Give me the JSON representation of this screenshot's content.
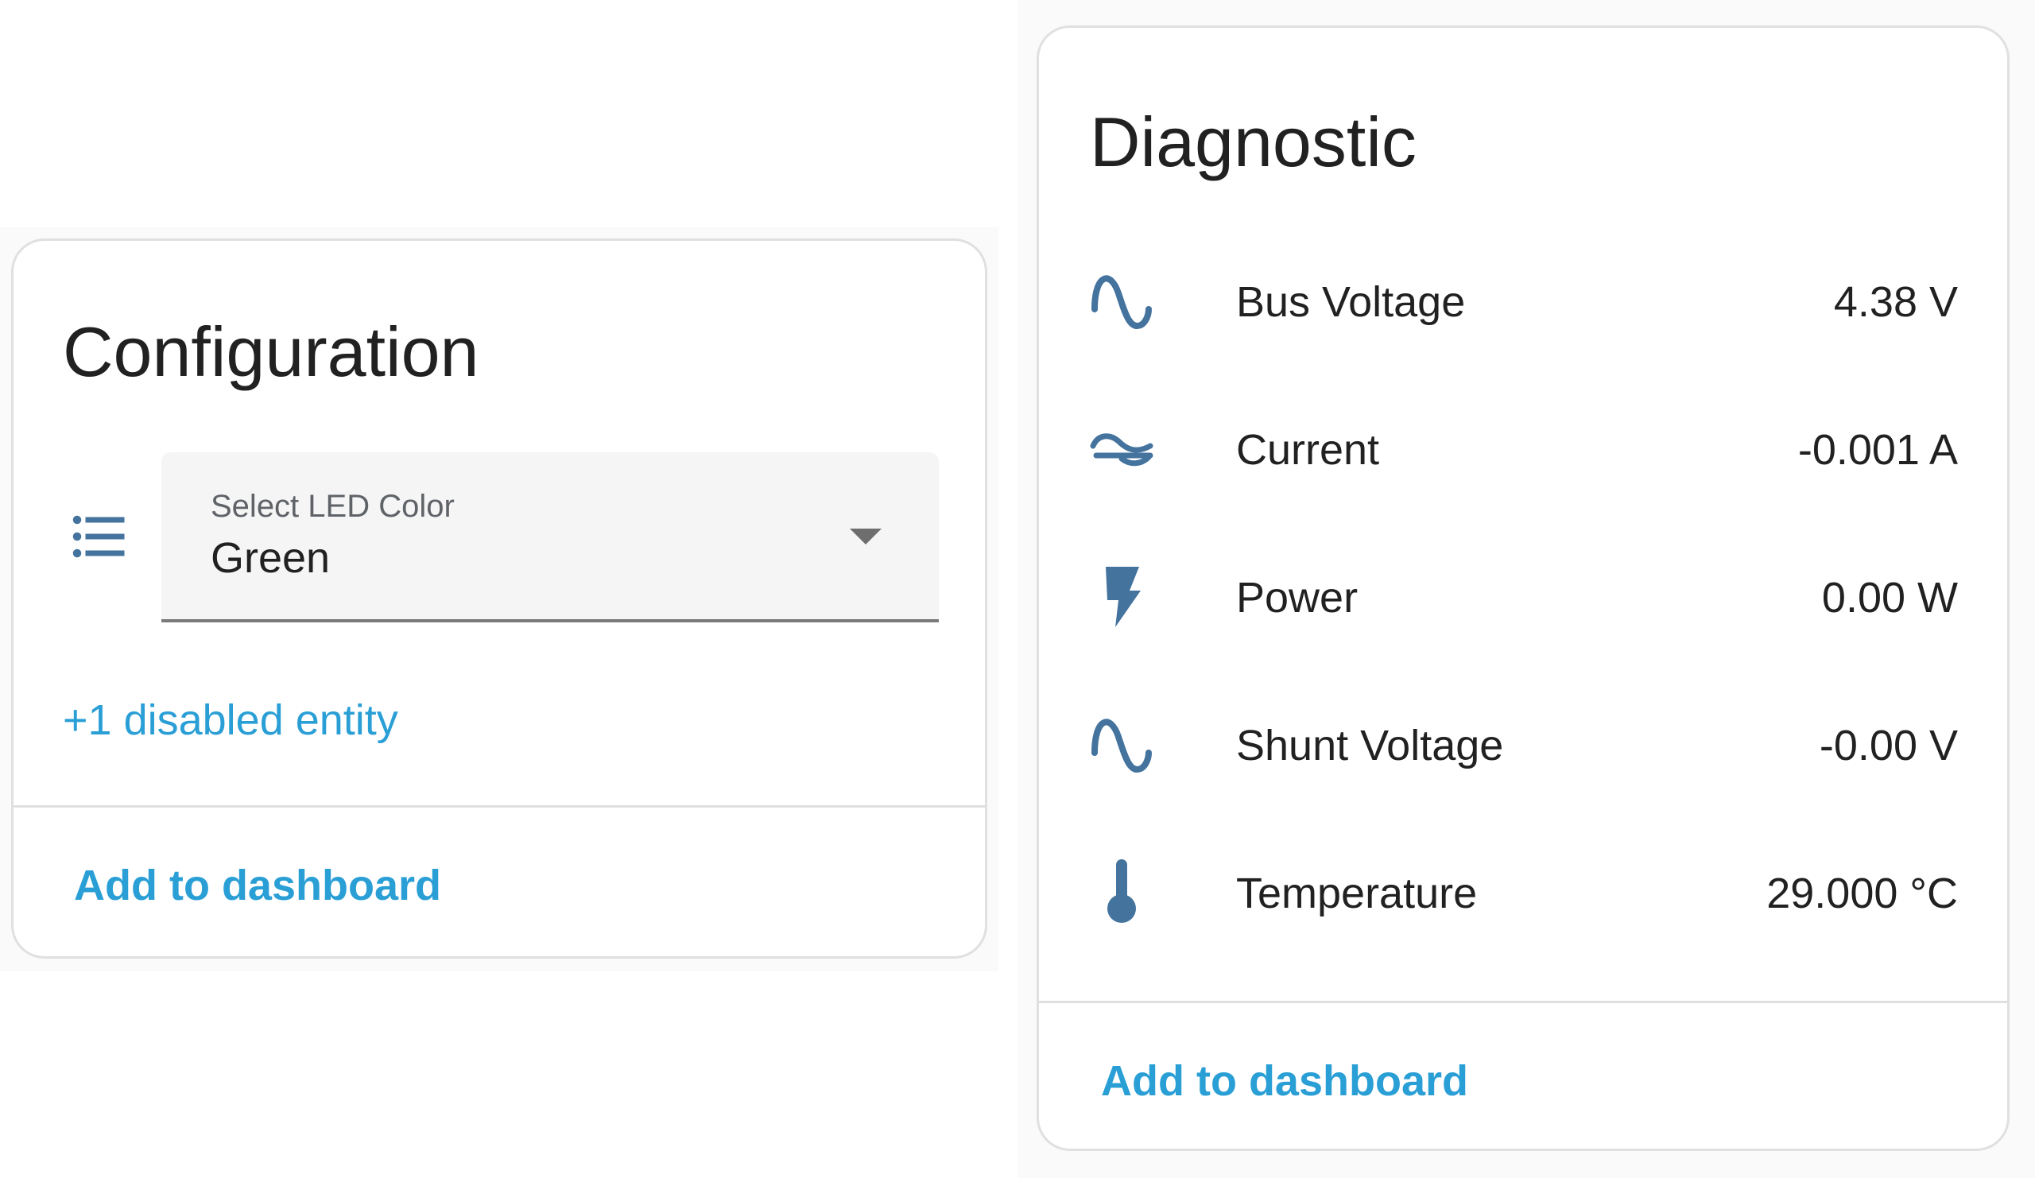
{
  "configuration": {
    "title": "Configuration",
    "select": {
      "icon": "format-list-bulleted-icon",
      "label": "Select LED Color",
      "value": "Green"
    },
    "disabled_entities_link": "+1 disabled entity",
    "add_to_dashboard": "Add to dashboard"
  },
  "diagnostic": {
    "title": "Diagnostic",
    "rows": [
      {
        "icon": "sine-wave-icon",
        "name": "Bus Voltage",
        "value": "4.38 V"
      },
      {
        "icon": "current-ac-icon",
        "name": "Current",
        "value": "-0.001 A"
      },
      {
        "icon": "flash-icon",
        "name": "Power",
        "value": "0.00 W"
      },
      {
        "icon": "sine-wave-icon",
        "name": "Shunt Voltage",
        "value": "-0.00 V"
      },
      {
        "icon": "thermometer-icon",
        "name": "Temperature",
        "value": "29.000 °C"
      }
    ],
    "add_to_dashboard": "Add to dashboard"
  },
  "colors": {
    "accent": "#2a9fd6",
    "icon": "#44739e",
    "card_border": "#e0e0e0",
    "field_background": "#f5f5f5"
  }
}
